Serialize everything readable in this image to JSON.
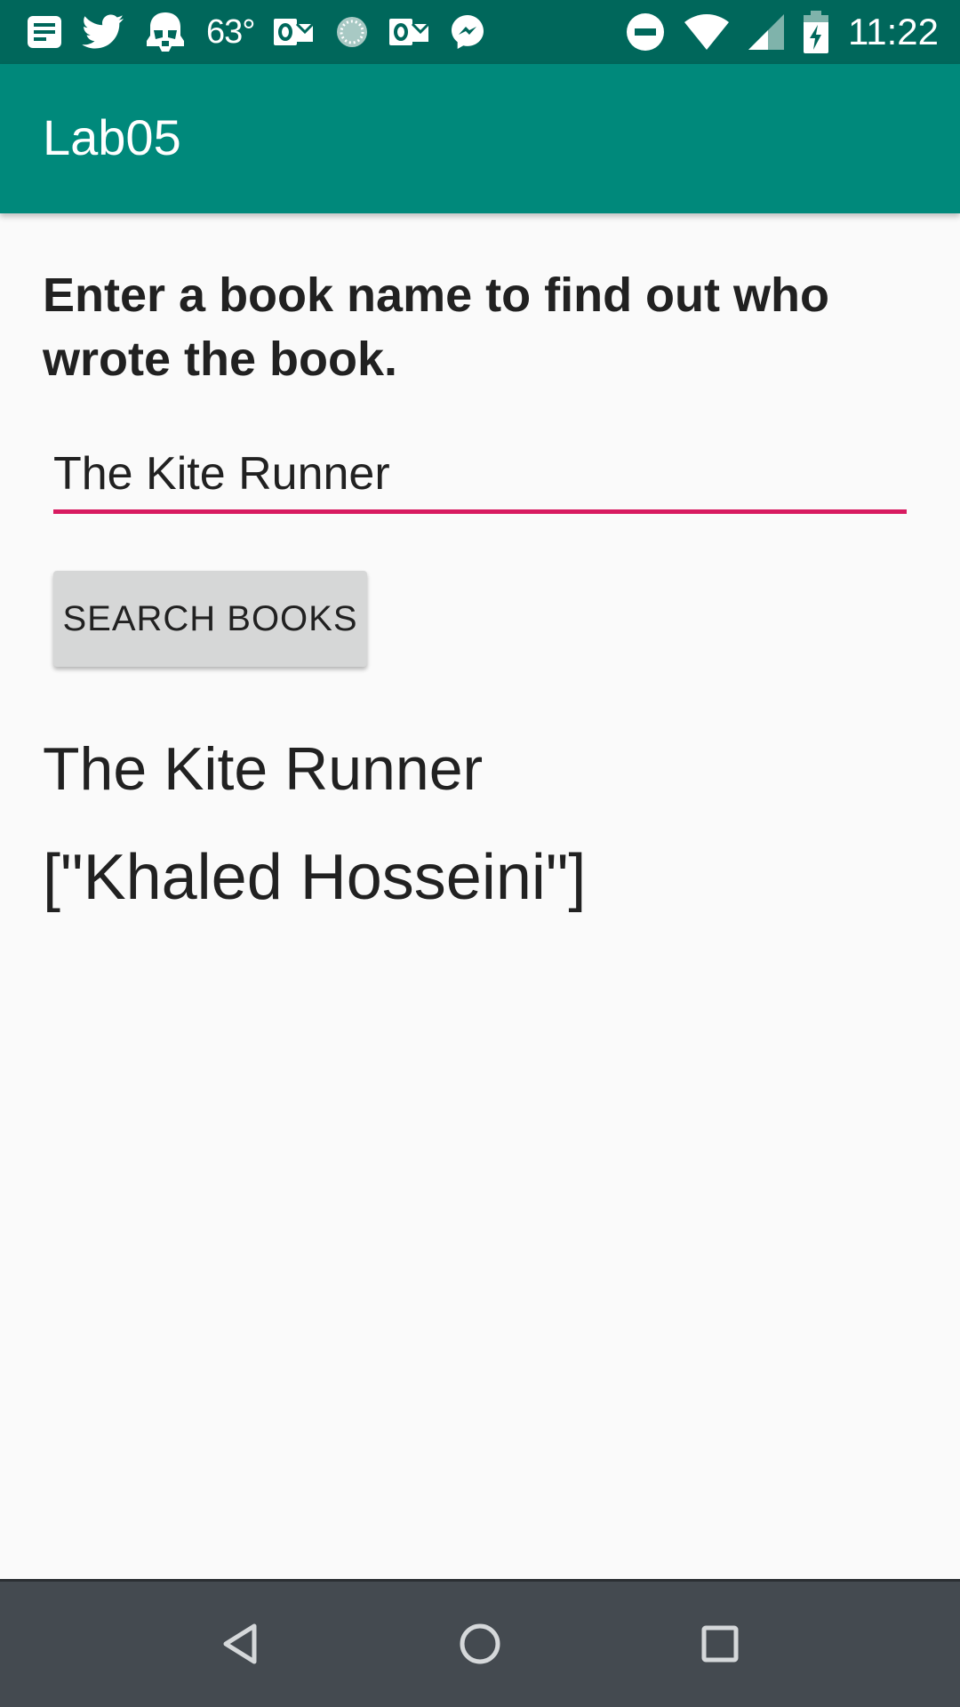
{
  "status_bar": {
    "left_icons": [
      "notes-icon",
      "twitter-icon",
      "stormtrooper-icon"
    ],
    "temperature": "63°",
    "middle_icons": [
      "outlook-icon",
      "sync-spinner-icon",
      "outlook-icon",
      "messenger-icon"
    ],
    "right_icons": [
      "do-not-disturb-icon",
      "wifi-icon",
      "cell-signal-icon",
      "battery-charging-icon"
    ],
    "time": "11:22"
  },
  "app_bar": {
    "title": "Lab05"
  },
  "main": {
    "prompt": "Enter a book name to find out who wrote the book.",
    "search_input_value": "The Kite Runner",
    "search_button_label": "SEARCH BOOKS",
    "result_title": "The Kite Runner",
    "result_author": "[\"Khaled Hosseini\"]"
  },
  "nav_bar": {
    "icons": [
      "back-icon",
      "home-icon",
      "recents-icon"
    ]
  },
  "colors": {
    "status_bar": "#00675b",
    "app_bar": "#00897b",
    "accent": "#d81b60",
    "background": "#fafafa",
    "button": "#d6d7d7",
    "nav_bar": "#444a50"
  }
}
